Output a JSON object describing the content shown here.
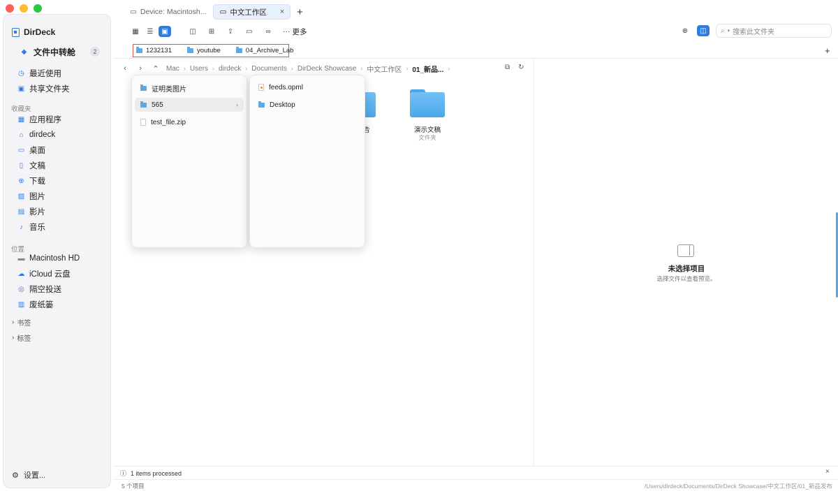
{
  "app": {
    "name": "DirDeck"
  },
  "tabs": [
    {
      "label": "Device: Macintosh..."
    },
    {
      "label": "中文工作区",
      "close": "×"
    }
  ],
  "tab_add": "+",
  "sidebar": {
    "station": {
      "label": "文件中转舱",
      "badge": "2"
    },
    "top_items": [
      {
        "label": "最近使用"
      },
      {
        "label": "共享文件夹"
      }
    ],
    "favorites_heading": "收藏夹",
    "favorites": [
      {
        "label": "应用程序"
      },
      {
        "label": "dirdeck"
      },
      {
        "label": "桌面"
      },
      {
        "label": "文稿"
      },
      {
        "label": "下载"
      },
      {
        "label": "图片"
      },
      {
        "label": "影片"
      },
      {
        "label": "音乐"
      }
    ],
    "locations_heading": "位置",
    "locations": [
      {
        "label": "Macintosh HD"
      },
      {
        "label": "iCloud 云盘"
      },
      {
        "label": "隔空投送"
      },
      {
        "label": "废纸篓"
      }
    ],
    "bookmarks_heading": "书签",
    "tags_heading": "标签",
    "settings": "设置..."
  },
  "toolbar": {
    "more": "更多"
  },
  "search": {
    "placeholder": "搜索此文件夹"
  },
  "bookmarks": [
    {
      "label": "1232131"
    },
    {
      "label": "youtube"
    },
    {
      "label": "04_Archive_Lab"
    }
  ],
  "bookmark_add": "+",
  "breadcrumb": [
    "Mac",
    "Users",
    "dirdeck",
    "Documents",
    "DirDeck Showcase",
    "中文工作区",
    "01_新品..."
  ],
  "grid": [
    {
      "name": "告",
      "type": ""
    },
    {
      "name": "演示文稿",
      "type": "文件夹"
    }
  ],
  "popup_left": [
    {
      "label": "证明类图片"
    },
    {
      "label": "565"
    },
    {
      "label": "test_file.zip"
    }
  ],
  "popup_right": [
    {
      "label": "feeds.opml"
    },
    {
      "label": "Desktop"
    }
  ],
  "preview": {
    "title": "未选择项目",
    "subtitle": "选择文件以查看预览。"
  },
  "status": {
    "message": "1 items processed",
    "close": "×"
  },
  "footer": {
    "count": "5 个项目",
    "path": "/Users/dirdeck/Documents/DirDeck Showcase/中文工作区/01_新品发布"
  },
  "colors": {
    "accent": "#2f7de1",
    "folder": "#4aa8ea",
    "highlight_border": "#d9534f"
  }
}
